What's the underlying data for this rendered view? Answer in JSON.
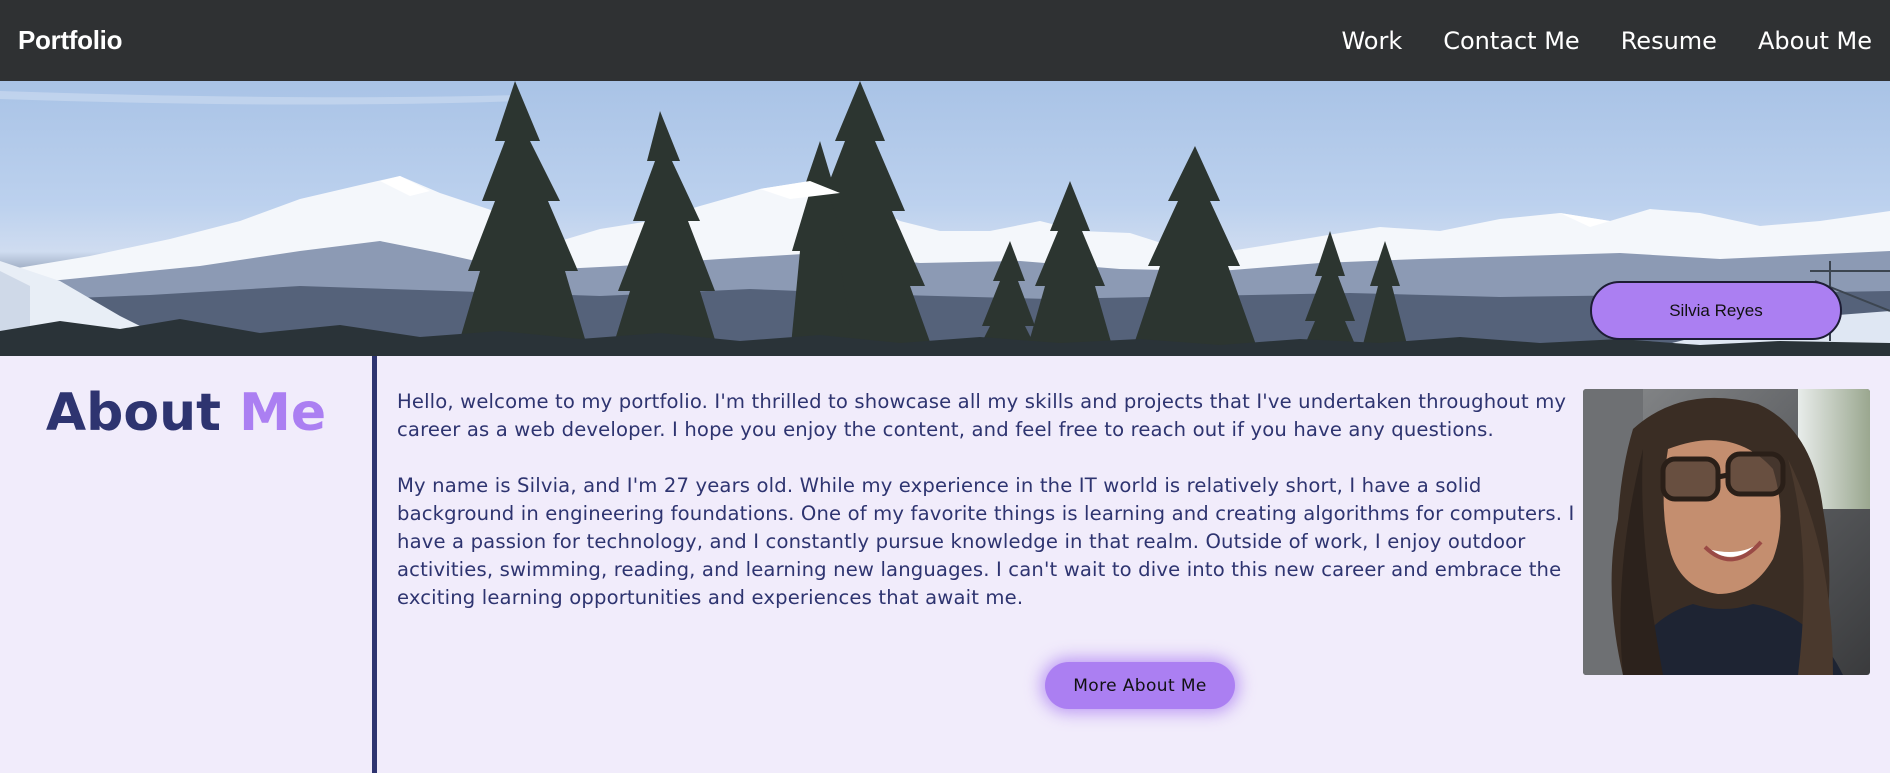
{
  "nav": {
    "brand": "Portfolio",
    "links": [
      {
        "label": "Work"
      },
      {
        "label": "Contact Me"
      },
      {
        "label": "Resume"
      },
      {
        "label": "About Me"
      }
    ]
  },
  "hero": {
    "name_badge": "Silvia Reyes"
  },
  "about": {
    "heading_part1": "About",
    "heading_part2": "Me",
    "paragraph1": "Hello, welcome to my portfolio. I'm thrilled to showcase all my skills and projects that I've undertaken throughout my career as a web developer. I hope you enjoy the content, and feel free to reach out if you have any questions.",
    "paragraph2": "My name is Silvia, and I'm 27 years old. While my experience in the IT world is relatively short, I have a solid background in engineering foundations. One of my favorite things is learning and creating algorithms for computers. I have a passion for technology, and I constantly pursue knowledge in that realm. Outside of work, I enjoy outdoor activities, swimming, reading, and learning new languages. I can't wait to dive into this new career and embrace the exciting learning opportunities and experiences that await me.",
    "more_button": "More About Me"
  },
  "colors": {
    "nav_bg": "#2f3133",
    "accent": "#ab7ff2",
    "navy": "#2e3470",
    "page_bg": "#f1ecfb"
  }
}
